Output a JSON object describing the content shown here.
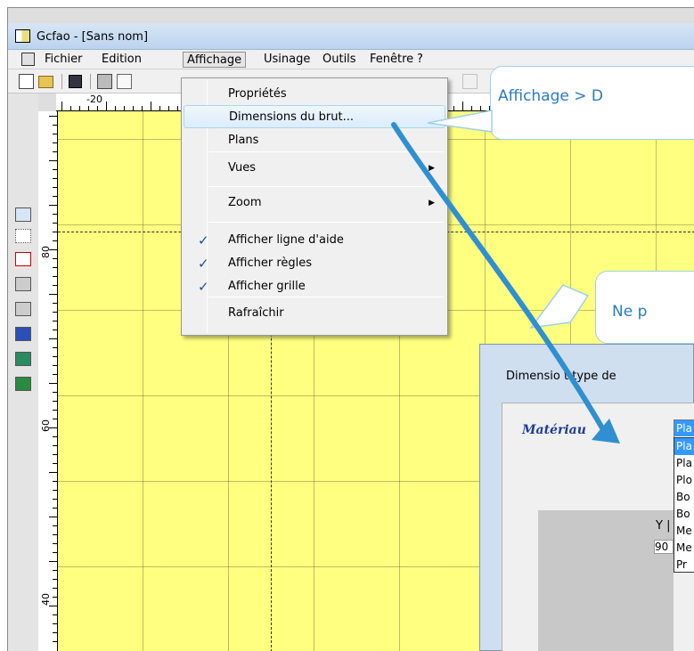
{
  "window": {
    "title": "Gcfao - [Sans nom]"
  },
  "menubar": {
    "items": [
      "Fichier",
      "Edition",
      "Affichage",
      "Usinage",
      "Outils",
      "Fenêtre",
      "?"
    ],
    "active": "Affichage"
  },
  "dropdown": {
    "items": [
      {
        "label": "Propriétés",
        "checked": false,
        "submenu": false
      },
      {
        "label": "Dimensions du brut...",
        "checked": false,
        "submenu": false,
        "highlighted": true
      },
      {
        "label": "Plans",
        "checked": false,
        "submenu": false
      },
      {
        "label": "Vues",
        "checked": false,
        "submenu": true
      },
      {
        "label": "Zoom",
        "checked": false,
        "submenu": true
      },
      {
        "label": "Afficher ligne d'aide",
        "checked": true,
        "submenu": false
      },
      {
        "label": "Afficher règles",
        "checked": true,
        "submenu": false
      },
      {
        "label": "Afficher grille",
        "checked": true,
        "submenu": false
      },
      {
        "label": "Rafraîchir",
        "checked": false,
        "submenu": false
      }
    ],
    "check_glyph": "✓",
    "arrow_glyph": "▶"
  },
  "ruler": {
    "h_label": "-20",
    "v_labels": [
      "80",
      "60",
      "40"
    ]
  },
  "callouts": {
    "first": "Affichage > D",
    "second": "Ne p"
  },
  "dialog": {
    "title": "Dimensio   t type de",
    "material_label": "Matériau",
    "combo_value": "Pla",
    "list_items": [
      "Pla",
      "Pla",
      "Plo",
      "Bo",
      "Bo",
      "Me",
      "Me",
      "Pr"
    ],
    "y_label": "Y |",
    "y_value": "90"
  },
  "colors": {
    "canvas": "#ffff80",
    "callout_text": "#2a7bc0",
    "callout_border": "#9fcfea",
    "arrow": "#2f8fd0",
    "highlight": "#3399ff"
  }
}
